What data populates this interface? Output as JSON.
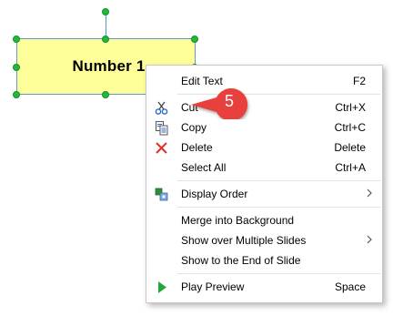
{
  "shape": {
    "text": "Number 1",
    "fill_color": "#ffff99",
    "border_color": "#5b9bd5",
    "handle_color": "#22b83a"
  },
  "context_menu": {
    "items": [
      {
        "label": "Edit Text",
        "shortcut": "F2",
        "icon": "",
        "submenu": false
      },
      {
        "label": "Cut",
        "shortcut": "Ctrl+X",
        "icon": "scissors-icon",
        "submenu": false
      },
      {
        "label": "Copy",
        "shortcut": "Ctrl+C",
        "icon": "copy-icon",
        "submenu": false
      },
      {
        "label": "Delete",
        "shortcut": "Delete",
        "icon": "delete-x-icon",
        "submenu": false
      },
      {
        "label": "Select All",
        "shortcut": "Ctrl+A",
        "icon": "",
        "submenu": false
      },
      {
        "label": "Display Order",
        "shortcut": "",
        "icon": "display-order-icon",
        "submenu": true
      },
      {
        "label": "Merge into Background",
        "shortcut": "",
        "icon": "",
        "submenu": false
      },
      {
        "label": "Show over Multiple Slides",
        "shortcut": "",
        "icon": "",
        "submenu": true
      },
      {
        "label": "Show to the End of Slide",
        "shortcut": "",
        "icon": "",
        "submenu": false
      },
      {
        "label": "Play Preview",
        "shortcut": "Space",
        "icon": "play-icon",
        "submenu": false
      }
    ]
  },
  "callout": {
    "number": "5",
    "color": "#e8413c"
  }
}
